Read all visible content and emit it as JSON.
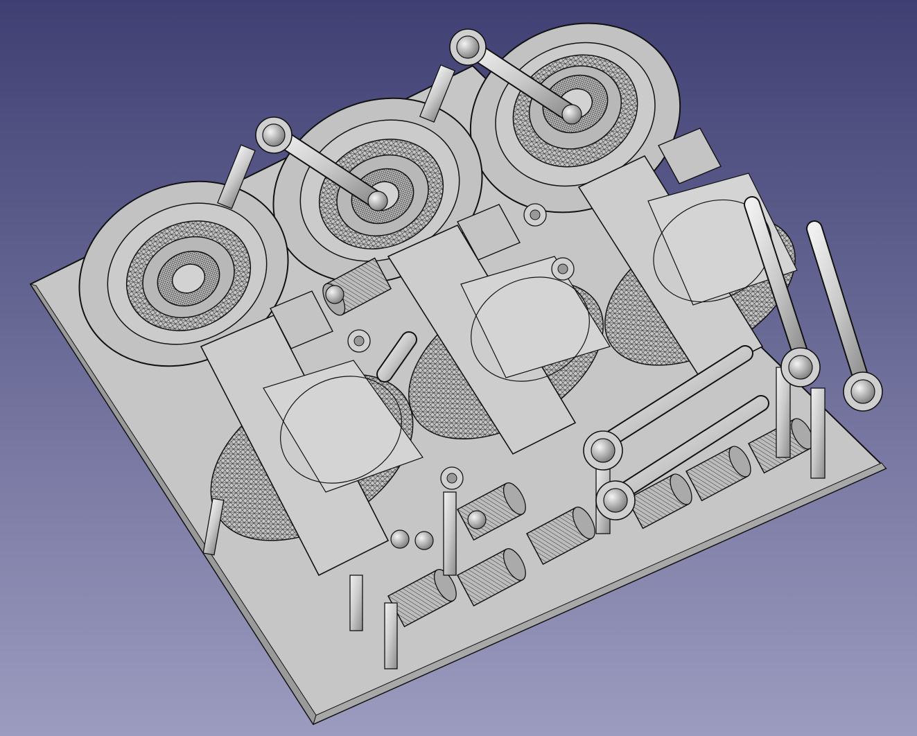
{
  "viewport": {
    "background_top": "#3f3f73",
    "background_bottom": "#9c9cc0",
    "render_mode": "flat-lines"
  },
  "model": {
    "base_plate_color": "#c4c4c4",
    "part_color": "#c8c8c8",
    "edge_color": "#1a1a1a",
    "module_count": 3
  }
}
